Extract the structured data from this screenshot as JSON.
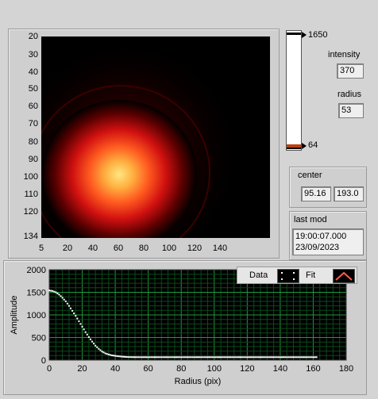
{
  "image_plot": {
    "y_ticks": [
      "20",
      "30",
      "40",
      "50",
      "60",
      "70",
      "80",
      "90",
      "100",
      "110",
      "120",
      "134"
    ],
    "x_ticks": [
      "5",
      "20",
      "40",
      "60",
      "80",
      "100",
      "120",
      "140"
    ]
  },
  "colorbar": {
    "max_label": "1650",
    "min_label": "64"
  },
  "intensity": {
    "label": "intensity",
    "value": "370"
  },
  "radius": {
    "label": "radius",
    "value": "53"
  },
  "center": {
    "label": "center",
    "x": "95.16",
    "y": "193.0"
  },
  "last_mod": {
    "label": "last mod",
    "line1": "19:00:07.000",
    "line2": "23/09/2023"
  },
  "legend": {
    "data_label": "Data",
    "fit_label": "Fit"
  },
  "chart_data": {
    "type": "scatter",
    "xlabel": "Radius (pix)",
    "ylabel": "Amplitude",
    "xlim": [
      0,
      180
    ],
    "ylim": [
      0,
      2000
    ],
    "x_ticks": [
      "0",
      "20",
      "40",
      "60",
      "80",
      "100",
      "120",
      "140",
      "160",
      "180"
    ],
    "y_ticks": [
      "2000",
      "1500",
      "1000",
      "500",
      "0"
    ],
    "grid": true,
    "legend_position": "top-right",
    "series": [
      {
        "name": "Data",
        "x": [
          0,
          2,
          4,
          6,
          8,
          10,
          12,
          14,
          16,
          18,
          20,
          22,
          24,
          26,
          28,
          30,
          32,
          34,
          36,
          38,
          40,
          42,
          44,
          46,
          48,
          50,
          55,
          60,
          70,
          80,
          90,
          100,
          110,
          120,
          130,
          140,
          150,
          160,
          162
        ],
        "y": [
          1540,
          1530,
          1500,
          1450,
          1380,
          1300,
          1200,
          1090,
          980,
          860,
          740,
          620,
          510,
          410,
          320,
          250,
          190,
          150,
          125,
          105,
          95,
          85,
          78,
          72,
          68,
          66,
          65,
          65,
          65,
          65,
          65,
          65,
          65,
          65,
          65,
          65,
          65,
          65,
          65
        ]
      }
    ]
  }
}
